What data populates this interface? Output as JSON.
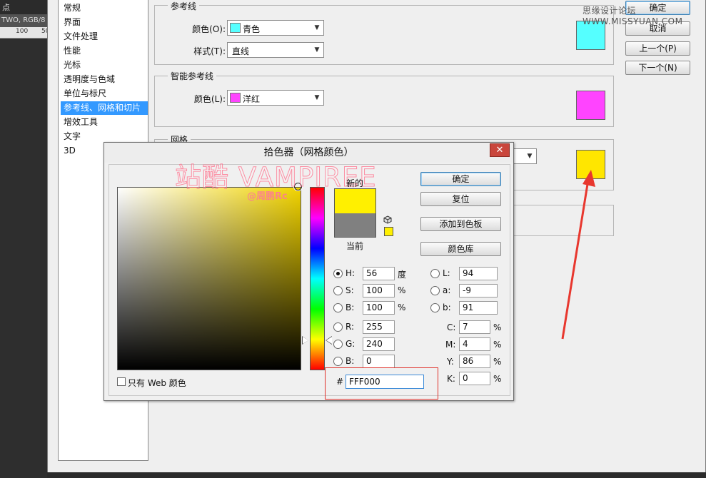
{
  "ps": {
    "title": "点",
    "doc_info": "TWO, RGB/8",
    "ruler_ticks": [
      "100",
      "50"
    ]
  },
  "watermark_site": "思缘设计论坛 WWW.MISSYUAN.COM",
  "categories": [
    {
      "label": "常规",
      "selected": false
    },
    {
      "label": "界面",
      "selected": false
    },
    {
      "label": "文件处理",
      "selected": false
    },
    {
      "label": "性能",
      "selected": false
    },
    {
      "label": "光标",
      "selected": false
    },
    {
      "label": "透明度与色域",
      "selected": false
    },
    {
      "label": "单位与标尺",
      "selected": false
    },
    {
      "label": "参考线、网格和切片",
      "selected": true
    },
    {
      "label": "增效工具",
      "selected": false
    },
    {
      "label": "文字",
      "selected": false
    },
    {
      "label": "3D",
      "selected": false
    }
  ],
  "guides": {
    "legend": "参考线",
    "color_label": "颜色(O):",
    "color_value": "青色",
    "color_hex": "#55ffff",
    "style_label": "样式(T):",
    "style_value": "直线"
  },
  "smart_guides": {
    "legend": "智能参考线",
    "color_label": "颜色(L):",
    "color_value": "洋红",
    "color_hex": "#ff44ff"
  },
  "grid": {
    "legend": "网格",
    "color_hex": "#ffe600"
  },
  "prefs_buttons": {
    "ok": "确定",
    "cancel": "取消",
    "prev": "上一个(P)",
    "next": "下一个(N)"
  },
  "picker": {
    "title": "拾色器（网格颜色）",
    "close_glyph": "✕",
    "ok": "确定",
    "reset": "复位",
    "add_swatch": "添加到色板",
    "libraries": "颜色库",
    "new_label": "新的",
    "current_label": "当前",
    "new_color": "#fff000",
    "current_color": "#808080",
    "web_only_label": "只有 Web 颜色",
    "watermark_main": "站酷 VAMPIREE",
    "watermark_sub": "@周鹏Rc",
    "hsb": {
      "h_label": "H:",
      "h_value": "56",
      "h_unit": "度",
      "s_label": "S:",
      "s_value": "100",
      "s_unit": "%",
      "b_label": "B:",
      "b_value": "100",
      "b_unit": "%"
    },
    "rgb": {
      "r_label": "R:",
      "r_value": "255",
      "g_label": "G:",
      "g_value": "240",
      "b_label": "B:",
      "b_value": "0"
    },
    "lab": {
      "l_label": "L:",
      "l_value": "94",
      "a_label": "a:",
      "a_value": "-9",
      "b_label": "b:",
      "b_value": "91"
    },
    "cmyk": {
      "c_label": "C:",
      "c_value": "7",
      "m_label": "M:",
      "m_value": "4",
      "y_label": "Y:",
      "y_value": "86",
      "k_label": "K:",
      "k_value": "0",
      "unit": "%"
    },
    "hex_label": "#",
    "hex_value": "FFF000"
  },
  "accent_colors": {
    "selection": "#3399ff",
    "annotation_red": "#e0302a"
  }
}
